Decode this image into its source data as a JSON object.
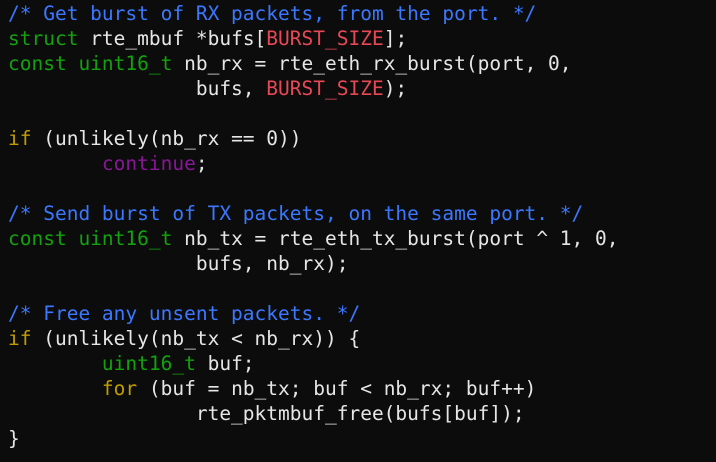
{
  "colors": {
    "background": "#0c0c0c",
    "plain": "#e6e6e6",
    "comment": "#3b78ff",
    "keyword": "#13a10e",
    "macro": "#e74856",
    "control": "#881798",
    "statement": "#c19c00"
  },
  "lines": [
    [
      [
        "comment",
        "/* Get burst of RX packets, from the port. */"
      ]
    ],
    [
      [
        "keyword",
        "struct"
      ],
      [
        "plain",
        " rte_mbuf *bufs["
      ],
      [
        "macro",
        "BURST_SIZE"
      ],
      [
        "plain",
        "];"
      ]
    ],
    [
      [
        "keyword",
        "const uint16_t"
      ],
      [
        "plain",
        " nb_rx = rte_eth_rx_burst(port, 0,"
      ]
    ],
    [
      [
        "plain",
        "                bufs, "
      ],
      [
        "macro",
        "BURST_SIZE"
      ],
      [
        "plain",
        ");"
      ]
    ],
    [],
    [
      [
        "statement",
        "if"
      ],
      [
        "plain",
        " (unlikely(nb_rx == 0))"
      ]
    ],
    [
      [
        "plain",
        "        "
      ],
      [
        "control",
        "continue"
      ],
      [
        "plain",
        ";"
      ]
    ],
    [],
    [
      [
        "comment",
        "/* Send burst of TX packets, on the same port. */"
      ]
    ],
    [
      [
        "keyword",
        "const uint16_t"
      ],
      [
        "plain",
        " nb_tx = rte_eth_tx_burst(port ^ 1, 0,"
      ]
    ],
    [
      [
        "plain",
        "                bufs, nb_rx);"
      ]
    ],
    [],
    [
      [
        "comment",
        "/* Free any unsent packets. */"
      ]
    ],
    [
      [
        "statement",
        "if"
      ],
      [
        "plain",
        " (unlikely(nb_tx < nb_rx)) {"
      ]
    ],
    [
      [
        "plain",
        "        "
      ],
      [
        "keyword",
        "uint16_t"
      ],
      [
        "plain",
        " buf;"
      ]
    ],
    [
      [
        "plain",
        "        "
      ],
      [
        "statement",
        "for"
      ],
      [
        "plain",
        " (buf = nb_tx; buf < nb_rx; buf++)"
      ]
    ],
    [
      [
        "plain",
        "                rte_pktmbuf_free(bufs[buf]);"
      ]
    ],
    [
      [
        "plain",
        "}"
      ]
    ]
  ]
}
